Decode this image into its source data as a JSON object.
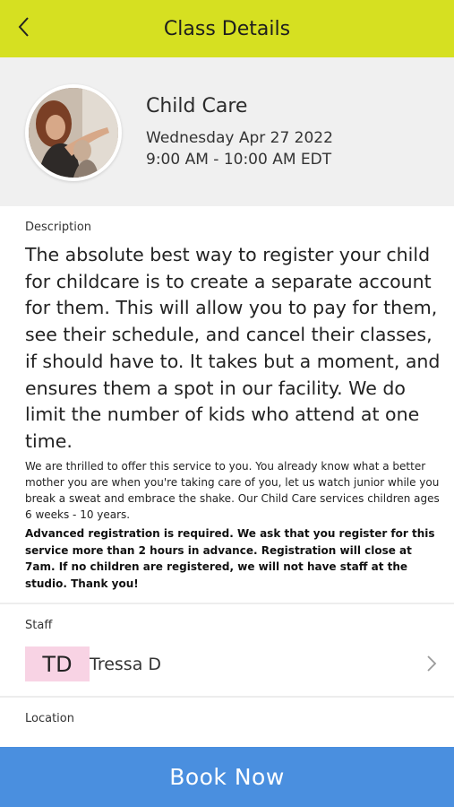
{
  "header": {
    "title": "Class Details",
    "back_icon": "chevron-left-icon"
  },
  "class_info": {
    "name": "Child Care",
    "date": "Wednesday Apr 27 2022",
    "time": "9:00 AM - 10:00 AM EDT"
  },
  "description": {
    "label": "Description",
    "main_text": "The absolute best way to register your child for childcare is to create a separate account for them. This will allow you to pay for them, see their schedule, and cancel their classes, if should have to. It takes but a moment, and ensures them a spot in our facility. We do limit the number of kids who attend at one time.",
    "body_text": "We are thrilled to offer this service to you. You already know what a better mother you are when you're taking care of you, let us watch junior while you break a sweat and embrace the shake. Our Child Care services children ages 6 weeks - 10 years.",
    "bold_text": "Advanced registration is required. We ask that you register for this service more than 2 hours in advance. Registration will close at 7am. If no children are registered, we will not have staff at the studio. Thank you!"
  },
  "staff": {
    "label": "Staff",
    "initials": "TD",
    "name": "Tressa D",
    "chevron_icon": "chevron-right-icon"
  },
  "location": {
    "label": "Location"
  },
  "actions": {
    "book_label": "Book Now"
  },
  "colors": {
    "header_bg": "#d6e021",
    "book_button_bg": "#4a8fdf",
    "initials_bg": "#f8d3e4"
  }
}
